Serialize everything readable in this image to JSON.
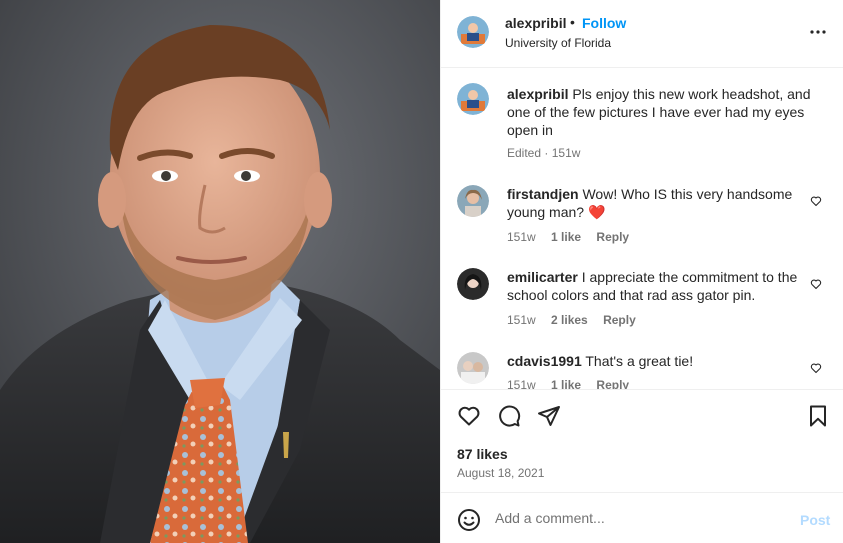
{
  "post": {
    "photo_alt": "Headshot of a man in a dark suit, light blue shirt and orange floral tie",
    "header": {
      "username": "alexpribil",
      "separator": "•",
      "follow_label": "Follow",
      "location": "University of Florida",
      "more_icon": "more-horizontal-icon"
    },
    "caption": {
      "username": "alexpribil",
      "text": "Pls enjoy this new work headshot, and one of the few pictures I have ever had my eyes open in",
      "edited": "Edited",
      "time": "151w"
    },
    "comments": [
      {
        "username": "firstandjen",
        "text": "Wow! Who IS this very handsome young man?",
        "emoji": "❤️",
        "time": "151w",
        "likes": "1 like",
        "reply": "Reply"
      },
      {
        "username": "emilicarter",
        "text": "I appreciate the commitment to the school colors and that rad ass gator pin.",
        "time": "151w",
        "likes": "2 likes",
        "reply": "Reply"
      },
      {
        "username": "cdavis1991",
        "text": "That's a great tie!",
        "time": "151w",
        "likes": "1 like",
        "reply": "Reply"
      }
    ],
    "actions": {
      "like_icon": "heart-icon",
      "comment_icon": "comment-icon",
      "share_icon": "share-icon",
      "save_icon": "bookmark-icon"
    },
    "likes_count": "87 likes",
    "date": "August 18, 2021",
    "add_comment": {
      "placeholder": "Add a comment...",
      "post_label": "Post",
      "emoji_icon": "emoji-icon"
    },
    "colors": {
      "link_blue": "#0095f6",
      "post_disabled": "#b3dbff",
      "heart_red": "#ff3040",
      "muted_text": "#737373"
    }
  }
}
